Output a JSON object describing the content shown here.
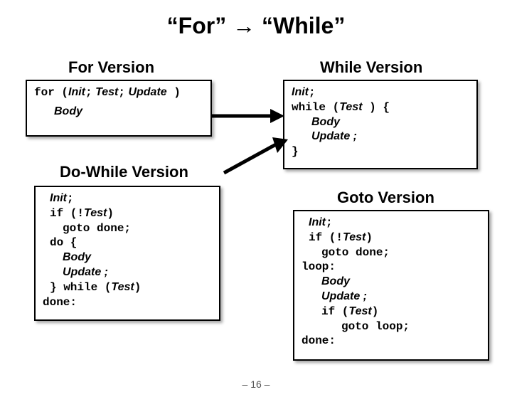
{
  "title": "“For” → “While”",
  "headings": {
    "for_version": "For Version",
    "while_version": "While Version",
    "do_while_version": "Do-While Version",
    "goto_version": "Goto Version"
  },
  "tokens": {
    "for_kw": "for (",
    "init": "Init",
    "semi": ";",
    "test": "Test",
    "update": "Update",
    "rparen": " )",
    "body": "Body",
    "while_kw": "while (",
    "lbrace": " ) {",
    "update_semi": "Update ;",
    "rbrace": "}",
    "if_not": "if (!",
    "rparen_plain": ")",
    "goto_done": "goto done;",
    "do_brace": "do {",
    "close_while": "} while (",
    "done_label": "done:",
    "loop_label": "loop:",
    "if_kw": "if (",
    "goto_loop": "goto loop;"
  },
  "page_number": "– 16 –"
}
